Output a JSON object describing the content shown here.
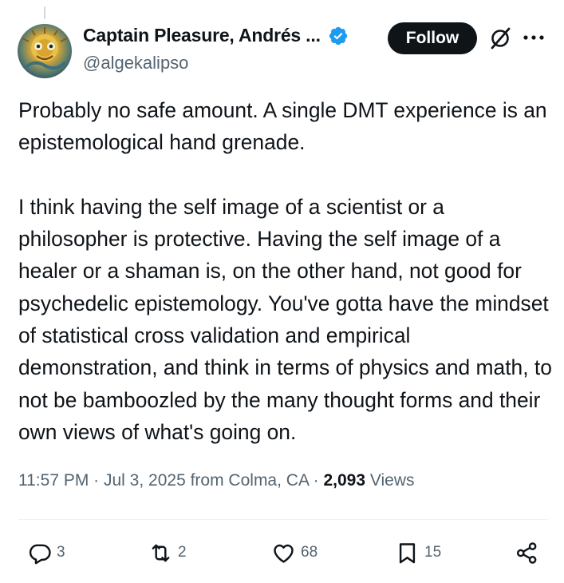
{
  "author": {
    "display_name": "Captain Pleasure, Andrés ...",
    "handle": "@algekalipso",
    "verified": true
  },
  "header": {
    "follow_label": "Follow",
    "icons": [
      "grok-icon",
      "more-icon"
    ]
  },
  "tweet": {
    "paragraphs": [
      "Probably no safe amount. A single DMT experience is an epistemological hand grenade.",
      "I think having the self image of a scientist or a philosopher is protective. Having the self image of a healer or a shaman is, on the other hand, not good for psychedelic epistemology. You've gotta have the mindset of statistical cross validation and empirical demonstration, and think in terms of physics and math, to not be bamboozled by the many thought forms and their own views of what's going on."
    ],
    "time": "11:57 PM",
    "date": "Jul 3, 2025",
    "location": "from Colma, CA",
    "views_count": "2,093",
    "views_label": "Views"
  },
  "actions": {
    "replies": "3",
    "reposts": "2",
    "likes": "68",
    "bookmarks": "15"
  },
  "colors": {
    "text": "#0f1419",
    "secondary": "#536471",
    "verified": "#1d9bf0",
    "follow_bg": "#0f1419"
  }
}
